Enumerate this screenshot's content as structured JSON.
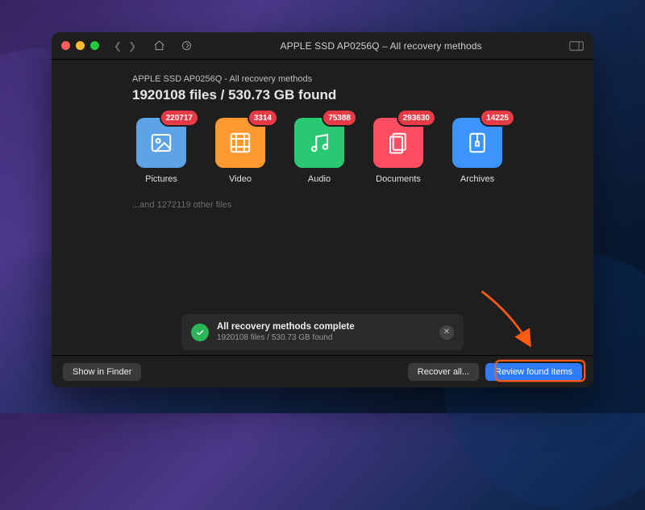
{
  "window": {
    "title": "APPLE SSD AP0256Q – All recovery methods"
  },
  "breadcrumb": "APPLE SSD AP0256Q - All recovery methods",
  "headline": "1920108 files / 530.73 GB found",
  "tiles": [
    {
      "label": "Pictures",
      "badge": "220717",
      "color": "#5ea3e8",
      "icon": "image"
    },
    {
      "label": "Video",
      "badge": "3314",
      "color": "#ff9930",
      "icon": "film"
    },
    {
      "label": "Audio",
      "badge": "75388",
      "color": "#28c972",
      "icon": "music"
    },
    {
      "label": "Documents",
      "badge": "293630",
      "color": "#ff4d62",
      "icon": "docs"
    },
    {
      "label": "Archives",
      "badge": "14225",
      "color": "#3c94ff",
      "icon": "zip"
    }
  ],
  "other_files_text": "...and 1272119 other files",
  "status": {
    "title": "All recovery methods complete",
    "subtitle": "1920108 files / 530.73 GB found"
  },
  "footer": {
    "show_in_finder": "Show in Finder",
    "recover_all": "Recover all...",
    "review": "Review found items"
  }
}
